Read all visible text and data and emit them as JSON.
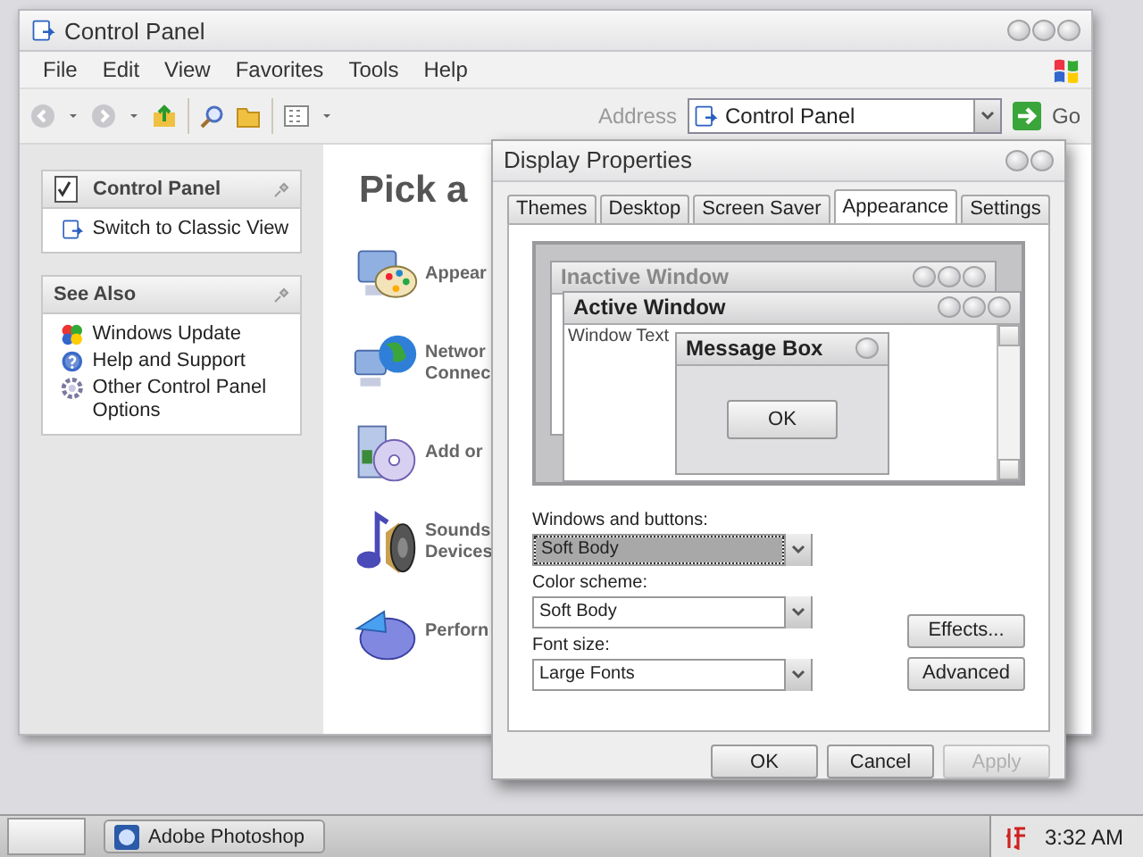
{
  "main_window": {
    "title": "Control Panel",
    "menu": [
      "File",
      "Edit",
      "View",
      "Favorites",
      "Tools",
      "Help"
    ],
    "address_bar": {
      "label": "Address",
      "value": "Control Panel",
      "go": "Go"
    },
    "task_panes": [
      {
        "title": "Control Panel",
        "links": [
          "Switch to Classic View"
        ]
      },
      {
        "title": "See Also",
        "links": [
          "Windows Update",
          "Help and Support",
          "Other Control Panel Options"
        ]
      }
    ],
    "heading": "Pick a",
    "categories": [
      {
        "lines": [
          "Appear"
        ]
      },
      {
        "lines": [
          "Networ",
          "Connec"
        ]
      },
      {
        "lines": [
          "Add or"
        ]
      },
      {
        "lines": [
          "Sounds",
          "Devices"
        ]
      },
      {
        "lines": [
          "Perforn"
        ]
      }
    ]
  },
  "dialog": {
    "title": "Display Properties",
    "tabs": [
      {
        "label": "Themes",
        "selected": false
      },
      {
        "label": "Desktop",
        "selected": false
      },
      {
        "label": "Screen Saver",
        "selected": false
      },
      {
        "label": "Appearance",
        "selected": true
      },
      {
        "label": "Settings",
        "selected": false
      }
    ],
    "preview": {
      "inactive_title": "Inactive Window",
      "active_title": "Active Window",
      "window_text": "Window Text",
      "message_title": "Message Box",
      "message_button": "OK"
    },
    "settings": [
      {
        "label": "Windows and buttons:",
        "value": "Soft Body",
        "focused": true
      },
      {
        "label": "Color scheme:",
        "value": "Soft Body",
        "focused": false
      },
      {
        "label": "Font size:",
        "value": "Large Fonts",
        "focused": false
      }
    ],
    "side_buttons": [
      "Effects...",
      "Advanced"
    ],
    "buttons": [
      {
        "label": "OK",
        "disabled": false
      },
      {
        "label": "Cancel",
        "disabled": false
      },
      {
        "label": "Apply",
        "disabled": true
      }
    ]
  },
  "taskbar": {
    "tasks": [
      {
        "label": "Adobe Photoshop"
      }
    ],
    "clock": "3:32 AM"
  }
}
